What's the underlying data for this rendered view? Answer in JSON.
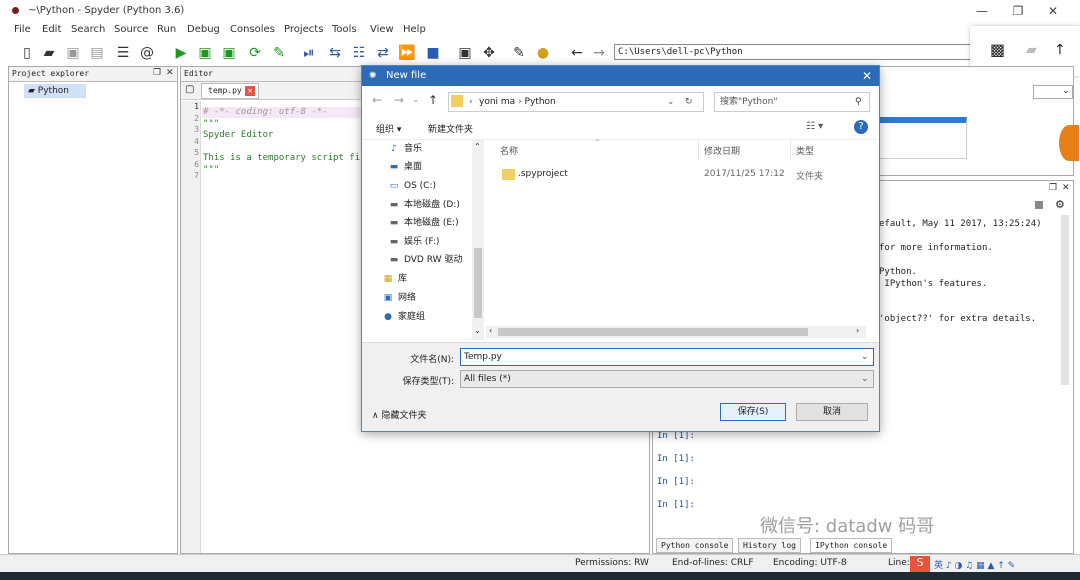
{
  "window": {
    "title": "~\\Python - Spyder (Python 3.6)",
    "min": "—",
    "max": "❐",
    "close": "✕"
  },
  "menu": [
    "File",
    "Edit",
    "Search",
    "Source",
    "Run",
    "Debug",
    "Consoles",
    "Projects",
    "Tools",
    "View",
    "Help"
  ],
  "toolbar": {
    "path": "C:\\Users\\dell-pc\\Python"
  },
  "project_explorer": {
    "title": "Project explorer",
    "root": "Python"
  },
  "editor": {
    "title": "Editor",
    "tab": "temp.py",
    "line_numbers": [
      "1",
      "2",
      "3",
      "4",
      "5",
      "6",
      "7"
    ],
    "lines": [
      "# -*- coding: utf-8 -*-",
      "\"\"\"",
      "Spyder Editor",
      "",
      "This is a temporary script fi",
      "\"\"\"",
      ""
    ]
  },
  "console": {
    "lines": [
      "efault, May 11 2017, 13:25:24)",
      "",
      "for more information.",
      "",
      "Python.",
      " IPython's features.",
      "",
      "",
      "'object??' for extra details."
    ],
    "prompts": [
      "In [1]:",
      "In [1]:",
      "In [1]:",
      "In [1]:"
    ],
    "tabs": [
      "Python console",
      "History log",
      "IPython console"
    ]
  },
  "statusbar": {
    "permissions": "Permissions: RW",
    "eol": "End-of-lines: CRLF",
    "encoding": "Encoding: UTF-8",
    "line": "Line:"
  },
  "watermark": "微信号: datadw 码哥",
  "dialog": {
    "title": "New file",
    "breadcrumb": [
      "yoni ma",
      "Python"
    ],
    "search_placeholder": "搜索\"Python\"",
    "organize": "组织 ▾",
    "new_folder": "新建文件夹",
    "nav_items": [
      {
        "icon": "music-icon",
        "glyph": "♪",
        "label": "音乐"
      },
      {
        "icon": "desktop-icon",
        "glyph": "▬",
        "label": "桌面"
      },
      {
        "icon": "drive-icon",
        "glyph": "▭",
        "label": "OS (C:)"
      },
      {
        "icon": "drive-icon",
        "glyph": "▬",
        "label": "本地磁盘 (D:)"
      },
      {
        "icon": "drive-icon",
        "glyph": "▬",
        "label": "本地磁盘 (E:)"
      },
      {
        "icon": "drive-icon",
        "glyph": "▬",
        "label": "娱乐 (F:)"
      },
      {
        "icon": "dvd-icon",
        "glyph": "▬",
        "label": "DVD RW 驱动"
      },
      {
        "icon": "library-icon",
        "glyph": "▦",
        "label": "库"
      },
      {
        "icon": "network-icon",
        "glyph": "▣",
        "label": "网络"
      },
      {
        "icon": "homegroup-icon",
        "glyph": "●",
        "label": "家庭组"
      }
    ],
    "columns": [
      "名称",
      "修改日期",
      "类型"
    ],
    "files": [
      {
        "name": ".spyproject",
        "date": "2017/11/25 17:12",
        "type": "文件夹"
      }
    ],
    "filename_label": "文件名(N):",
    "filename_value": "Temp.py",
    "filetype_label": "保存类型(T):",
    "filetype_value": "All files  (*)",
    "hide_folders": "隐藏文件夹",
    "save": "保存(S)",
    "cancel": "取消"
  }
}
